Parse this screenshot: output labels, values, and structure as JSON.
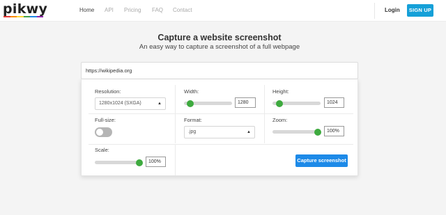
{
  "brand": {
    "logo_text": "pikwy",
    "logo_colors": [
      "#e53935",
      "#fb8c00",
      "#fdd835",
      "#43a047",
      "#1e88e5",
      "#8e24aa"
    ]
  },
  "nav": {
    "items": [
      {
        "label": "Home"
      },
      {
        "label": "API"
      },
      {
        "label": "Pricing"
      },
      {
        "label": "FAQ"
      },
      {
        "label": "Contact"
      }
    ],
    "signin_label": "Login",
    "signup_label": "SIGN UP"
  },
  "hero": {
    "title": "Capture a website screenshot",
    "subtitle": "An easy way to capture a screenshot of a full webpage"
  },
  "form": {
    "url_value": "https://wikipedia.org",
    "resolution": {
      "label": "Resolution:",
      "value": "1280x1024 (SXGA)"
    },
    "width": {
      "label": "Width:",
      "value": "1280"
    },
    "height": {
      "label": "Height:",
      "value": "1024"
    },
    "fullsize": {
      "label": "Full-size:",
      "enabled": false
    },
    "format": {
      "label": "Format:",
      "value": ".jpg"
    },
    "zoom": {
      "label": "Zoom:",
      "value": "100%"
    },
    "scale": {
      "label": "Scale:",
      "value": "100%"
    },
    "capture_label": "Capture screenshot"
  },
  "colors": {
    "accent_green": "#3eaa3f",
    "signup_blue": "#15a0d8",
    "capture_blue": "#1d8ae8"
  }
}
